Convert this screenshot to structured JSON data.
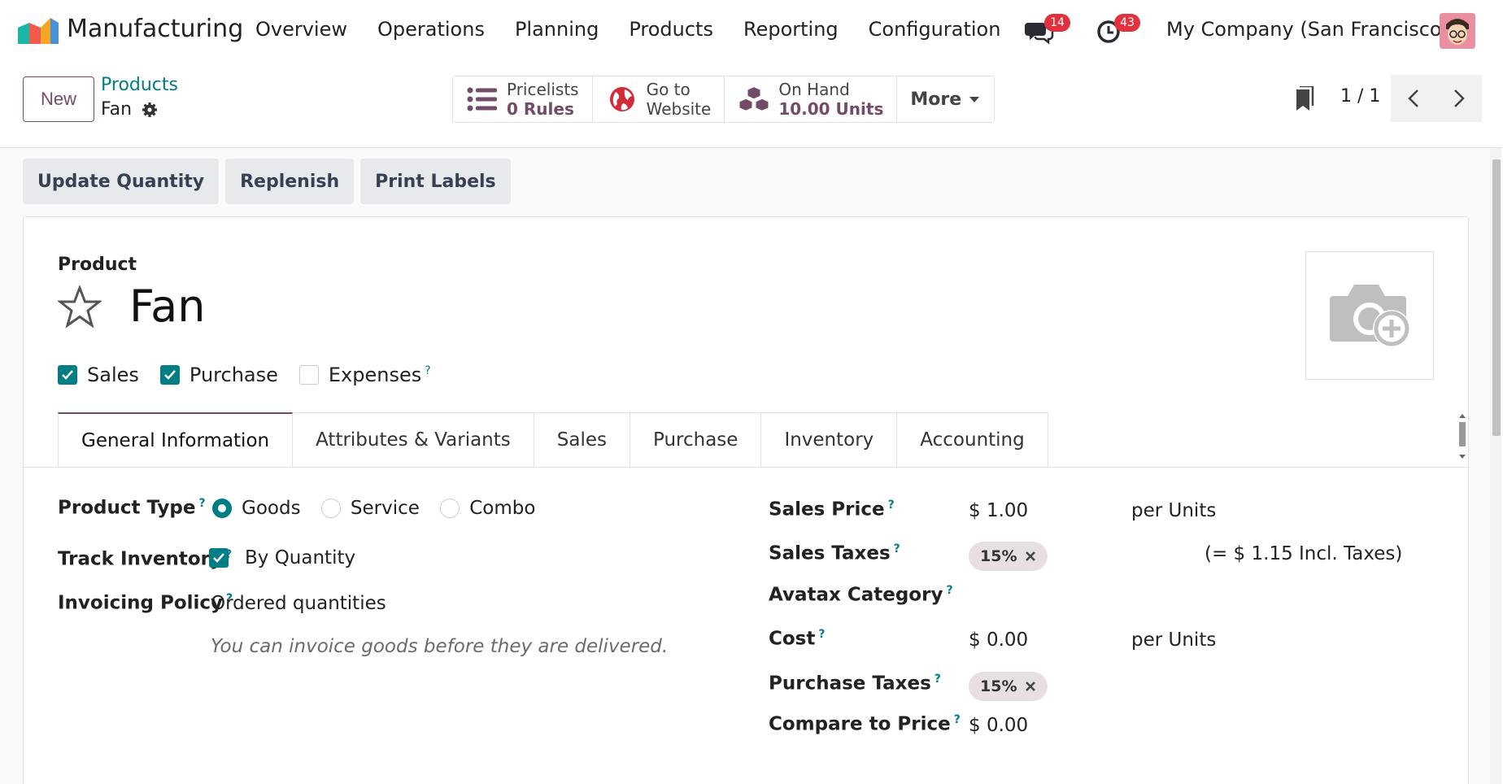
{
  "navbar": {
    "app_name": "Manufacturing",
    "menu": [
      "Overview",
      "Operations",
      "Planning",
      "Products",
      "Reporting",
      "Configuration"
    ],
    "messages_count": "14",
    "activities_count": "43",
    "company": "My Company (San Francisco)"
  },
  "control": {
    "new_label": "New",
    "breadcrumb_parent": "Products",
    "breadcrumb_current": "Fan",
    "smart_buttons": [
      {
        "line1": "Pricelists",
        "line2": "0  Rules",
        "icon": "list-icon"
      },
      {
        "line1": "Go to",
        "line2": "Website",
        "icon": "globe-icon"
      },
      {
        "line1": "On Hand",
        "line2": "10.00 Units",
        "icon": "cubes-icon"
      }
    ],
    "more_label": "More",
    "pager": "1 / 1"
  },
  "actions": [
    "Update Quantity",
    "Replenish",
    "Print Labels"
  ],
  "product": {
    "label": "Product",
    "name": "Fan",
    "checks": [
      {
        "label": "Sales",
        "checked": true
      },
      {
        "label": "Purchase",
        "checked": true
      },
      {
        "label": "Expenses",
        "checked": false,
        "help": "?"
      }
    ]
  },
  "tabs": [
    "General Information",
    "Attributes & Variants",
    "Sales",
    "Purchase",
    "Inventory",
    "Accounting"
  ],
  "general": {
    "product_type_label": "Product Type",
    "product_type_options": [
      "Goods",
      "Service",
      "Combo"
    ],
    "product_type_selected": "Goods",
    "track_inventory_label": "Track Inventory",
    "track_inventory_value": "By Quantity",
    "invoicing_policy_label": "Invoicing Policy",
    "invoicing_policy_value": "Ordered quantities",
    "invoicing_hint": "You can invoice goods before they are delivered.",
    "sales_price_label": "Sales Price",
    "sales_price_value": "$ 1.00",
    "sales_price_unit": "per Units",
    "sales_taxes_label": "Sales Taxes",
    "sales_taxes_tag": "15%",
    "sales_taxes_incl": "(= $ 1.15 Incl. Taxes)",
    "avatax_label": "Avatax Category",
    "cost_label": "Cost",
    "cost_value": "$ 0.00",
    "cost_unit": "per Units",
    "purchase_taxes_label": "Purchase Taxes",
    "purchase_taxes_tag": "15%",
    "compare_label": "Compare to Price",
    "compare_value": "$ 0.00"
  },
  "colors": {
    "accent": "#714b67",
    "teal": "#017e84",
    "badge": "#e0313e"
  }
}
